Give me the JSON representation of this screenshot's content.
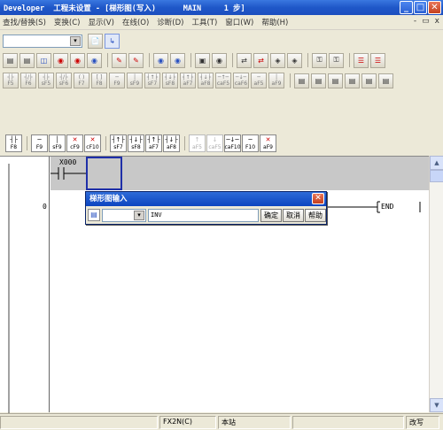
{
  "window": {
    "title": "Developer  工程未设置 - [梯形图(写入)      MAIN     1 步]",
    "min_glyph": "_",
    "max_glyph": "□",
    "close_glyph": "✕"
  },
  "menu": {
    "items": [
      "查找/替换(S)",
      "变换(C)",
      "显示(V)",
      "在线(O)",
      "诊断(D)",
      "工具(T)",
      "窗口(W)",
      "帮助(H)"
    ],
    "mdi_min": "-",
    "mdi_restore": "▭",
    "mdi_close": "x"
  },
  "toolbar": {
    "combo_value": "",
    "combo_arrow": "▾",
    "row1_glyphs": [
      "📄",
      "↳"
    ],
    "row2_glyphs": [
      "▤",
      "▤",
      "◫",
      "◉",
      "◉",
      "◉",
      "✎",
      "✎",
      "◉",
      "◉",
      "▣",
      "◉",
      "⇄",
      "⇄",
      "◈",
      "◈",
      "⚿",
      "⚿",
      "☰",
      "☰",
      "☰",
      "☰",
      "◉",
      "✎"
    ],
    "row3_labels": [
      [
        "┤├",
        "F5"
      ],
      [
        "┤/├",
        "F6"
      ],
      [
        "┤├",
        "sF5"
      ],
      [
        "┤/├",
        "sF6"
      ],
      [
        "( )",
        "F7"
      ],
      [
        "[ ]",
        "F8"
      ],
      [
        "─",
        "F9"
      ],
      [
        "│",
        "sF9"
      ],
      [
        "┤↑├",
        "sF7"
      ],
      [
        "┤↓├",
        "sF8"
      ],
      [
        "┤↑├",
        "aF7"
      ],
      [
        "┤↓├",
        "aF8"
      ],
      [
        "─↑─",
        "caF5"
      ],
      [
        "─↓─",
        "caF6"
      ],
      [
        "─",
        "aF5"
      ],
      [
        "│",
        "aF9"
      ],
      [
        "▭",
        "aF9"
      ],
      [
        "✕",
        "aF9"
      ]
    ],
    "row3b_glyphs": [
      "▤",
      "▤",
      "▤",
      "▤",
      "▤",
      "▤",
      "▤",
      "▤",
      "▤",
      "▤"
    ]
  },
  "ladder_toolbar": {
    "keys": [
      {
        "sym": "┤├",
        "label": "F8",
        "dim": false
      },
      {
        "sym": "─",
        "label": "F9",
        "dim": false
      },
      {
        "sym": "│",
        "label": "sF9",
        "dim": false
      },
      {
        "sym": "✕",
        "label": "cF9",
        "dim": false,
        "red": true
      },
      {
        "sym": "✕",
        "label": "cF10",
        "dim": false,
        "red": true
      },
      {
        "sym": "┤↑├",
        "label": "sF7",
        "dim": false
      },
      {
        "sym": "┤↓├",
        "label": "sF8",
        "dim": false
      },
      {
        "sym": "┤↑├",
        "label": "aF7",
        "dim": false
      },
      {
        "sym": "┤↓├",
        "label": "aF8",
        "dim": false
      },
      {
        "sym": "↑",
        "label": "aF5",
        "dim": true
      },
      {
        "sym": "↓",
        "label": "caF5",
        "dim": true
      },
      {
        "sym": "─↓─",
        "label": "caF10",
        "dim": false
      },
      {
        "sym": "─",
        "label": "F10",
        "dim": false
      },
      {
        "sym": "✕",
        "label": "aF9",
        "dim": false,
        "red": true
      }
    ]
  },
  "ladder": {
    "contact_label": "X000",
    "step_number": "0",
    "end_label": "END"
  },
  "dialog": {
    "title": "梯形图输入",
    "close_glyph": "✕",
    "icon_glyph": "▤",
    "combo_value": "",
    "combo_arrow": "▾",
    "input_value": "INV",
    "ok_label": "确定",
    "cancel_label": "取消",
    "help_label": "帮助"
  },
  "status": {
    "plc": "FX2N(C)",
    "station": "本站",
    "mode": "改写"
  },
  "scrollbar": {
    "up_glyph": "▲",
    "down_glyph": "▼"
  }
}
